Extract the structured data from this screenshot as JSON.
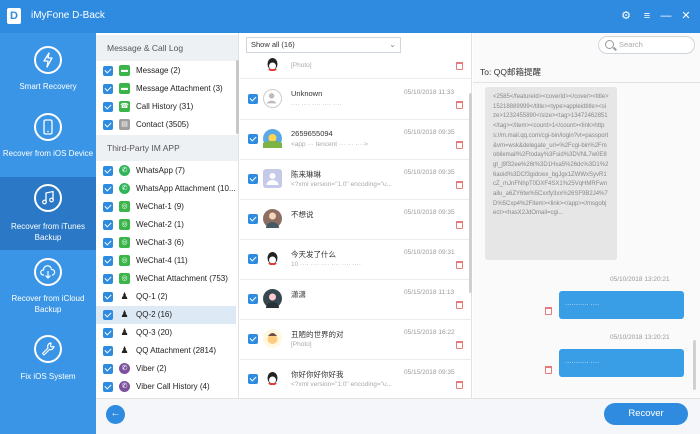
{
  "app": {
    "title": "iMyFone D-Back",
    "logo_letter": "D"
  },
  "window_controls": {
    "settings": "⚙",
    "menu": "≡",
    "minimize": "—",
    "close": "✕"
  },
  "nav": [
    {
      "label": "Smart Recovery",
      "icon": "lightning-icon",
      "active": false
    },
    {
      "label": "Recover from iOS Device",
      "icon": "phone-icon",
      "active": false
    },
    {
      "label": "Recover from iTunes Backup",
      "icon": "music-icon",
      "active": true
    },
    {
      "label": "Recover from iCloud Backup",
      "icon": "cloud-download-icon",
      "active": false
    },
    {
      "label": "Fix iOS System",
      "icon": "wrench-icon",
      "active": false
    }
  ],
  "categories": {
    "section1": "Message & Call Log",
    "section2": "Third-Party IM APP",
    "items1": [
      {
        "label": "Message (2)",
        "icon": "message-icon",
        "color": "#3bb54a"
      },
      {
        "label": "Message Attachment (3)",
        "icon": "message-attachment-icon",
        "color": "#3bb54a"
      },
      {
        "label": "Call History (31)",
        "icon": "phone-icon",
        "color": "#3bb54a"
      },
      {
        "label": "Contact (3505)",
        "icon": "contact-icon",
        "color": "#9e9e9e"
      }
    ],
    "items2": [
      {
        "label": "WhatsApp (7)",
        "icon": "whatsapp-icon",
        "color": "#2fb457",
        "selected": false
      },
      {
        "label": "WhatsApp Attachment (10...",
        "icon": "whatsapp-icon",
        "color": "#2fb457",
        "selected": false
      },
      {
        "label": "WeChat-1 (9)",
        "icon": "wechat-icon",
        "color": "#3bb54a",
        "selected": false
      },
      {
        "label": "WeChat-2 (1)",
        "icon": "wechat-icon",
        "color": "#3bb54a",
        "selected": false
      },
      {
        "label": "WeChat-3 (6)",
        "icon": "wechat-icon",
        "color": "#3bb54a",
        "selected": false
      },
      {
        "label": "WeChat-4 (11)",
        "icon": "wechat-icon",
        "color": "#3bb54a",
        "selected": false
      },
      {
        "label": "WeChat Attachment (753)",
        "icon": "wechat-icon",
        "color": "#3bb54a",
        "selected": false
      },
      {
        "label": "QQ-1 (2)",
        "icon": "qq-icon",
        "color": "#222222",
        "selected": false
      },
      {
        "label": "QQ-2 (16)",
        "icon": "qq-icon",
        "color": "#222222",
        "selected": true
      },
      {
        "label": "QQ-3 (20)",
        "icon": "qq-icon",
        "color": "#222222",
        "selected": false
      },
      {
        "label": "QQ Attachment (2814)",
        "icon": "qq-icon",
        "color": "#222222",
        "selected": false
      },
      {
        "label": "Viber (2)",
        "icon": "viber-icon",
        "color": "#7b519d",
        "selected": false
      },
      {
        "label": "Viber Call History (4)",
        "icon": "viber-icon",
        "color": "#7b519d",
        "selected": false
      }
    ]
  },
  "filter": {
    "value": "Show all (16)"
  },
  "search": {
    "placeholder": "Search"
  },
  "messages": [
    {
      "name": "",
      "preview": "[Photo]",
      "date": ""
    },
    {
      "name": "Unknown",
      "preview": "···· ···· ···· ···· ····",
      "date": "05/10/2018 11:33"
    },
    {
      "name": "2659655094",
      "preview": "<app ··· tencent ··· ··· ····>",
      "date": "05/10/2018 09:35"
    },
    {
      "name": "陈来琳琳",
      "preview": "<?xml version=\"1.0\" encoding=\"u...",
      "date": "05/10/2018 09:35"
    },
    {
      "name": "不想说",
      "preview": "",
      "date": "05/10/2018 09:35"
    },
    {
      "name": "今天发了什么",
      "preview": "10 ···· ···· ···· ···· ···· ····",
      "date": "05/10/2018 09:31"
    },
    {
      "name": "潇潇",
      "preview": "",
      "date": "05/15/2018 11:13"
    },
    {
      "name": "丑陋的世界的对",
      "preview": "[Photo]",
      "date": "05/15/2018 16:22"
    },
    {
      "name": "你好你好你好我",
      "preview": "<?xml version=\"1.0\" encoding=\"u...",
      "date": "05/15/2018 09:35"
    }
  ],
  "conversation": {
    "to_label": "To:",
    "to_name": "QQ邮箱提醒",
    "incoming_text": "<2585</featureId><coverId></cover><title>15218889999</title><type>appleidtitle><size>1232455890</size><tag>13472462851</tag></item><count>1</count><link>https://m.mail.qq.com/cgi-bin/login?vt=passport&vm=wsk&delegate_url=%2Fcgi-bin%2Fmobilemail%2Ftoday%3Fsid%3DVNL7w0E8gt_j9f32ee%26t%3D1Hxa5%26dc%3D1%26aoid%3DCf3gidcwx_bgJgx1ZWWxSyvR1cZ_mJnFNhpT0DXF4SX1%25VqHMRFwnailu_a6ZY6tw%5Cxxfy3xx%26SF9B2J4%7D%5Cxp4%2Fitem><link></app></msgobject><hasX2JdOmail=cgi..."
  },
  "outgoing": [
    {
      "time": "05/10/2018 13:20:21",
      "text": "··········· ····"
    },
    {
      "time": "05/10/2018 13:20:21",
      "text": "··········· ····"
    }
  ],
  "bottom": {
    "back": "←",
    "recover": "Recover"
  },
  "colors": {
    "primary": "#2f8bdf",
    "nav_bg": "#3a95e6",
    "nav_active": "#2a78c6",
    "bubble": "#3a9ee6"
  }
}
